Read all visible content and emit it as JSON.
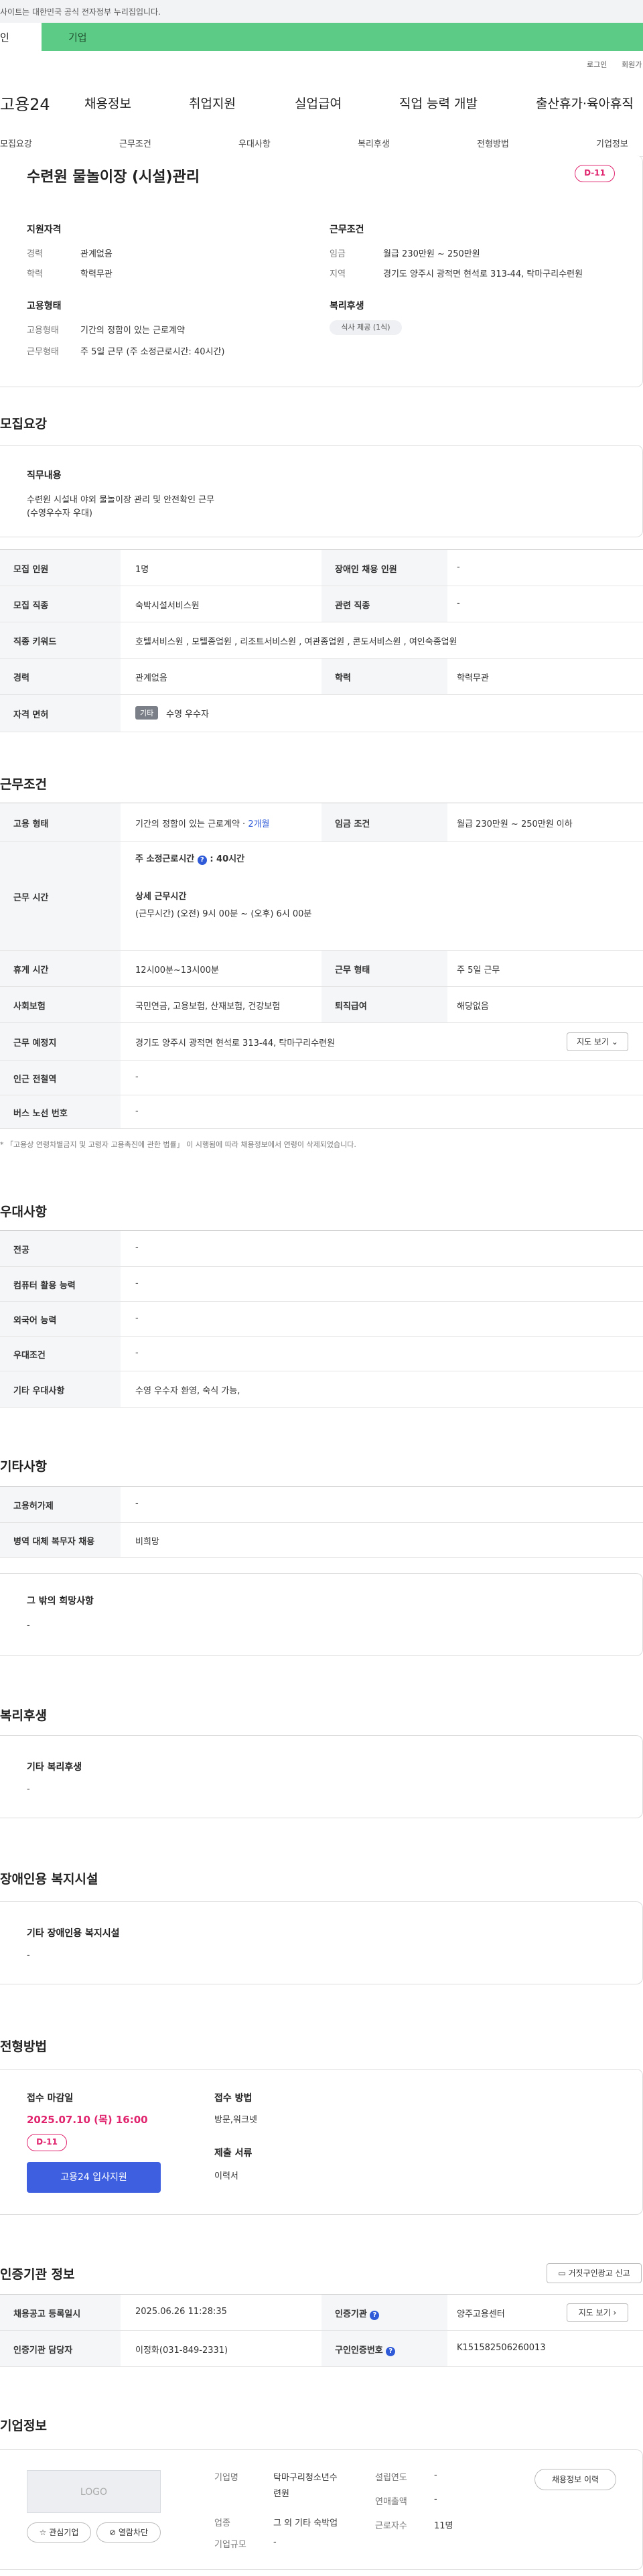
{
  "topbar": {
    "notice": "사이트는 대한민국 공식 전자정부 누리집입니다."
  },
  "tabs": {
    "individual": "인",
    "business": "기업"
  },
  "util": {
    "login": "로그인",
    "signup": "회원가"
  },
  "gnb": {
    "logo": "고용24",
    "items": [
      "채용정보",
      "취업지원",
      "실업급여",
      "직업 능력 개발",
      "출산휴가·육아휴직"
    ]
  },
  "subnav": {
    "items": [
      "모집요강",
      "근무조건",
      "우대사항",
      "복리후생",
      "전형방법",
      "기업정보"
    ]
  },
  "summary": {
    "title": "수련원 물놀이장 (시설)관리",
    "dday": "D-11",
    "qual_heading": "지원자격",
    "career_label": "경력",
    "career_value": "관계없음",
    "edu_label": "학력",
    "edu_value": "학력무관",
    "emp_heading": "고용형태",
    "emptype_label": "고용형태",
    "emptype_value": "기간의 정함이 있는 근로계약",
    "worktime_label": "근무형태",
    "worktime_value": "주 5일 근무 (주 소정근로시간: 40시간)",
    "cond_heading": "근무조건",
    "wage_label": "임금",
    "wage_value": "월급 230만원 ~ 250만원",
    "region_label": "지역",
    "region_value": "경기도 양주시 광적면 현석로 313-44, 탁마구리수련원",
    "welfare_heading": "복리후생",
    "welfare_chip": "식사 제공 (1식)"
  },
  "recruit": {
    "heading": "모집요강",
    "duty_heading": "직무내용",
    "duty_line1": "수련원 시설내  야외 물놀이장 관리 및 안전확인 근무",
    "duty_line2": "(수영우수자 우대)",
    "rows": {
      "count_label": "모집 인원",
      "count_value": "1명",
      "disabled_label": "장애인 채용 인원",
      "disabled_value": "-",
      "job_label": "모집 직종",
      "job_value": "숙박시설서비스원",
      "related_label": "관련 직종",
      "related_value": "-",
      "keyword_label": "직종 키워드",
      "keyword_value": "호텔서비스원 , 모텔종업원 , 리조트서비스원 , 여관종업원 , 콘도서비스원 , 여인숙종업원",
      "career_label": "경력",
      "career_value": "관계없음",
      "edu_label": "학력",
      "edu_value": "학력무관",
      "license_label": "자격 면허",
      "license_tag": "기타",
      "license_value": "수영 우수자"
    }
  },
  "work": {
    "heading": "근무조건",
    "emptype_label": "고용 형태",
    "emptype_value": "기간의 정함이 있는 근로계약 ·",
    "emptype_period": "2개월",
    "wage_label": "임금 조건",
    "wage_value": "월급 230만원 ~ 250만원 이하",
    "hours_label": "근무 시간",
    "hours_week": "주 소정근로시간",
    "hours_week_value": ": 40시간",
    "hours_detail_heading": "상세 근무시간",
    "hours_detail": "(근무시간) (오전) 9시 00분 ~ (오후) 6시 00분",
    "break_label": "휴게 시간",
    "break_value": "12시00분~13시00분",
    "form_label": "근무 형태",
    "form_value": "주 5일 근무",
    "insurance_label": "사회보험",
    "insurance_value": "국민연금, 고용보험, 산재보험, 건강보험",
    "retire_label": "퇴직급여",
    "retire_value": "해당없음",
    "place_label": "근무 예정지",
    "place_value": "경기도 양주시 광적면 현석로 313-44, 탁마구리수련원",
    "map_button": "지도 보기",
    "station_label": "인근 전철역",
    "station_value": "-",
    "bus_label": "버스 노선 번호",
    "bus_value": "-",
    "footnote": "「고용상 연령차별금지 및 고령자 고용촉진에 관한 법률」 이 시행됨에 따라 채용정보에서 연령이 삭제되었습니다."
  },
  "pref": {
    "heading": "우대사항",
    "major_label": "전공",
    "major_value": "-",
    "computer_label": "컴퓨터 활용 능력",
    "computer_value": "-",
    "lang_label": "외국어 능력",
    "lang_value": "-",
    "cond_label": "우대조건",
    "cond_value": "-",
    "etc_label": "기타 우대사항",
    "etc_value": "수영 우수자 환영,  숙식 가능,"
  },
  "etc": {
    "heading": "기타사항",
    "permit_label": "고용허가제",
    "permit_value": "-",
    "military_label": "병역 대체 복무자 채용",
    "military_value": "비희망",
    "hope_heading": "그 밖의 희망사항",
    "hope_value": "-"
  },
  "welfare": {
    "heading": "복리후생",
    "sub": "기타 복리후생",
    "value": "-"
  },
  "facility": {
    "heading": "장애인용 복지시설",
    "sub": "기타 장애인용 복지시설",
    "value": "-"
  },
  "selection": {
    "heading": "전형방법",
    "deadline_label": "접수 마감일",
    "deadline_value": "2025.07.10 (목) 16:00",
    "dday": "D-11",
    "apply_button": "고용24 입사지원",
    "method_label": "접수 방법",
    "method_value": "방문,워크넷",
    "docs_label": "제출 서류",
    "docs_value": "이력서"
  },
  "certify": {
    "heading": "인증기관 정보",
    "report_button": "거짓구인광고 신고",
    "reg_label": "채용공고 등록일시",
    "reg_value": "2025.06.26 11:28:35",
    "agency_label": "인증기관",
    "agency_value": "양주고용센터",
    "map_button": "지도 보기",
    "manager_label": "인증기관 담당자",
    "manager_value": "이정화(031-849-2331)",
    "number_label": "구인인증번호",
    "number_value": "K151582506260013"
  },
  "company": {
    "heading": "기업정보",
    "logo": "LOGO",
    "fav_button": "관심기업",
    "block_button": "열람차단",
    "name_label": "기업명",
    "name_value1": "탁마구리청소년수",
    "name_value2": "련원",
    "industry_label": "업종",
    "industry_value": "그 외 기타 숙박업",
    "size_label": "기업규모",
    "size_value": "-",
    "found_label": "설립연도",
    "found_value": "-",
    "sales_label": "연매출액",
    "sales_value": "-",
    "employees_label": "근로자수",
    "employees_value": "11명",
    "history_button": "채용정보 이력"
  }
}
